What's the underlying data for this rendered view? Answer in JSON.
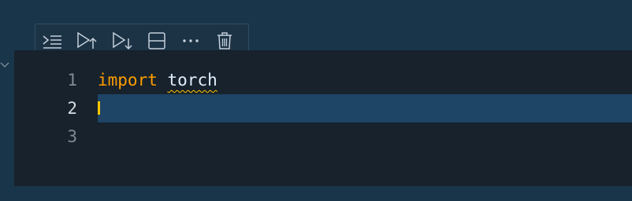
{
  "toolbar": {
    "buttons": [
      {
        "icon": "execute-above-icon",
        "label": ""
      },
      {
        "icon": "run-above-icon",
        "label": ""
      },
      {
        "icon": "run-below-icon",
        "label": ""
      },
      {
        "icon": "split-cell-icon",
        "label": ""
      },
      {
        "icon": "more-icon",
        "label": "⋯"
      },
      {
        "icon": "trash-icon",
        "label": ""
      }
    ]
  },
  "editor": {
    "line_numbers": [
      "1",
      "2",
      "3"
    ],
    "active_line": "2",
    "code": {
      "line1_keyword": "import",
      "line1_module": "torch"
    }
  },
  "colors": {
    "background": "#193549",
    "editor_background": "#17222c",
    "keyword": "#ff9d00",
    "current_line": "#1e4466",
    "cursor": "#ffc600",
    "warning_squiggle": "#ffc600"
  }
}
